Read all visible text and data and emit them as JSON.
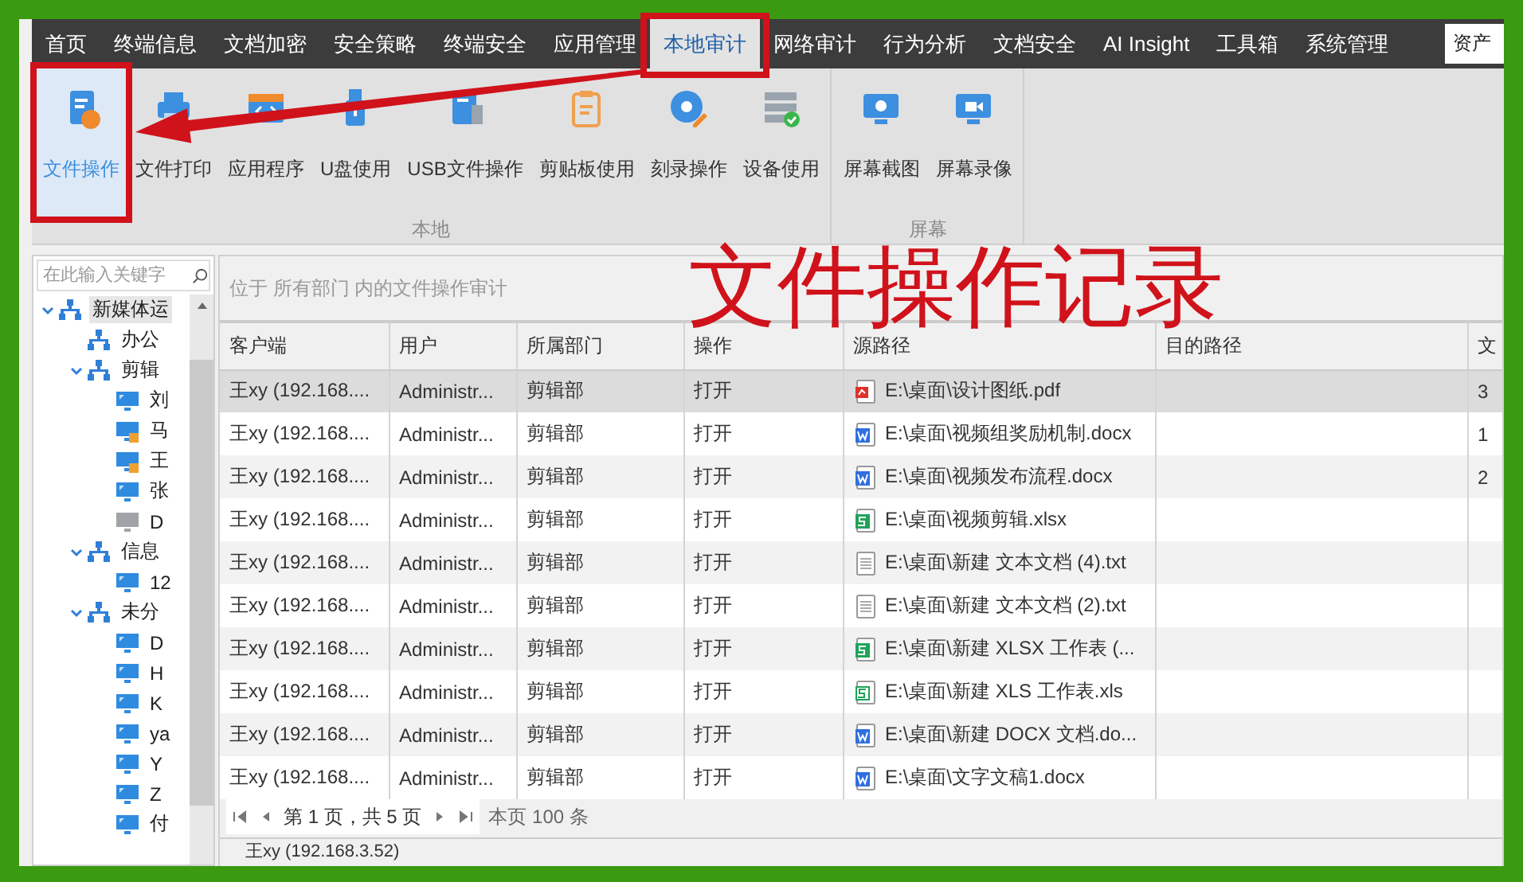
{
  "nav": {
    "items": [
      {
        "label": "首页",
        "selected": false
      },
      {
        "label": "终端信息",
        "selected": false
      },
      {
        "label": "文档加密",
        "selected": false
      },
      {
        "label": "安全策略",
        "selected": false
      },
      {
        "label": "终端安全",
        "selected": false
      },
      {
        "label": "应用管理",
        "selected": false
      },
      {
        "label": "本地审计",
        "selected": true
      },
      {
        "label": "网络审计",
        "selected": false
      },
      {
        "label": "行为分析",
        "selected": false
      },
      {
        "label": "文档安全",
        "selected": false
      },
      {
        "label": "AI Insight",
        "selected": false
      },
      {
        "label": "工具箱",
        "selected": false
      },
      {
        "label": "系统管理",
        "selected": false
      }
    ],
    "search": {
      "value": "资产"
    }
  },
  "ribbon": {
    "groups": [
      {
        "label": "本地",
        "items": [
          {
            "label": "文件操作",
            "selected": true
          },
          {
            "label": "文件打印",
            "selected": false
          },
          {
            "label": "应用程序",
            "selected": false
          },
          {
            "label": "U盘使用",
            "selected": false
          },
          {
            "label": "USB文件操作",
            "selected": false
          },
          {
            "label": "剪贴板使用",
            "selected": false
          },
          {
            "label": "刻录操作",
            "selected": false
          },
          {
            "label": "设备使用",
            "selected": false
          }
        ]
      },
      {
        "label": "屏幕",
        "items": [
          {
            "label": "屏幕截图",
            "selected": false
          },
          {
            "label": "屏幕录像",
            "selected": false
          }
        ]
      }
    ]
  },
  "sidebar": {
    "search": {
      "placeholder": "在此输入关键字"
    },
    "tree": [
      {
        "label": "新媒体运",
        "kind": "org",
        "selected": true,
        "expanded": true,
        "children": [
          {
            "label": "办公",
            "kind": "org",
            "selected": false
          },
          {
            "label": "剪辑",
            "kind": "org",
            "selected": false,
            "expanded": true,
            "children": [
              {
                "label": "刘",
                "kind": "computer",
                "selected": false
              },
              {
                "label": "马",
                "kind": "computer_locked",
                "selected": false
              },
              {
                "label": "王",
                "kind": "computer_locked",
                "selected": false
              },
              {
                "label": "张",
                "kind": "computer",
                "selected": false
              },
              {
                "label": "D",
                "kind": "computer_offline",
                "selected": false
              }
            ]
          },
          {
            "label": "信息",
            "kind": "org",
            "selected": false,
            "expanded": true,
            "children": [
              {
                "label": "12",
                "kind": "computer",
                "selected": false
              }
            ]
          },
          {
            "label": "未分",
            "kind": "org",
            "selected": false,
            "expanded": true,
            "children": [
              {
                "label": "D",
                "kind": "computer",
                "selected": false
              },
              {
                "label": "H",
                "kind": "computer",
                "selected": false
              },
              {
                "label": "K",
                "kind": "computer",
                "selected": false
              },
              {
                "label": "ya",
                "kind": "computer",
                "selected": false
              },
              {
                "label": "Y",
                "kind": "computer",
                "selected": false
              },
              {
                "label": "Z",
                "kind": "computer",
                "selected": false
              },
              {
                "label": "付",
                "kind": "computer",
                "selected": false
              }
            ]
          }
        ]
      }
    ]
  },
  "breadcrumb": "位于 所有部门 内的文件操作审计",
  "table": {
    "columns": [
      "客户端",
      "用户",
      "所属部门",
      "操作",
      "源路径",
      "目的路径",
      "文"
    ],
    "rows": [
      {
        "client": "王xy (192.168....",
        "user": "Administr...",
        "department": "剪辑部",
        "action": "打开",
        "source": {
          "kind": "pdf",
          "text": "E:\\桌面\\设计图纸.pdf"
        },
        "column_7": "3",
        "selected": true
      },
      {
        "client": "王xy (192.168....",
        "user": "Administr...",
        "department": "剪辑部",
        "action": "打开",
        "source": {
          "kind": "word",
          "text": "E:\\桌面\\视频组奖励机制.docx"
        },
        "column_7": "1",
        "selected": false
      },
      {
        "client": "王xy (192.168....",
        "user": "Administr...",
        "department": "剪辑部",
        "action": "打开",
        "source": {
          "kind": "word",
          "text": "E:\\桌面\\视频发布流程.docx"
        },
        "column_7": "2",
        "selected": false
      },
      {
        "client": "王xy (192.168....",
        "user": "Administr...",
        "department": "剪辑部",
        "action": "打开",
        "source": {
          "kind": "excel",
          "text": "E:\\桌面\\视频剪辑.xlsx"
        },
        "selected": false
      },
      {
        "client": "王xy (192.168....",
        "user": "Administr...",
        "department": "剪辑部",
        "action": "打开",
        "source": {
          "kind": "text",
          "text": "E:\\桌面\\新建 文本文档 (4).txt"
        },
        "selected": false
      },
      {
        "client": "王xy (192.168....",
        "user": "Administr...",
        "department": "剪辑部",
        "action": "打开",
        "source": {
          "kind": "text",
          "text": "E:\\桌面\\新建 文本文档 (2).txt"
        },
        "selected": false
      },
      {
        "client": "王xy (192.168....",
        "user": "Administr...",
        "department": "剪辑部",
        "action": "打开",
        "source": {
          "kind": "excel",
          "text": "E:\\桌面\\新建 XLSX 工作表 (..."
        },
        "selected": false
      },
      {
        "client": "王xy (192.168....",
        "user": "Administr...",
        "department": "剪辑部",
        "action": "打开",
        "source": {
          "kind": "excel_old",
          "text": "E:\\桌面\\新建 XLS 工作表.xls"
        },
        "selected": false
      },
      {
        "client": "王xy (192.168....",
        "user": "Administr...",
        "department": "剪辑部",
        "action": "打开",
        "source": {
          "kind": "word",
          "text": "E:\\桌面\\新建 DOCX 文档.do..."
        },
        "selected": false
      },
      {
        "client": "王xy (192.168....",
        "user": "Administr...",
        "department": "剪辑部",
        "action": "打开",
        "source": {
          "kind": "word",
          "text": "E:\\桌面\\文字文稿1.docx"
        },
        "selected": false
      }
    ]
  },
  "pagination": {
    "page_text": "第 1 页，共 5 页",
    "count_text": "本页 100 条"
  },
  "details": {
    "text": "王xy (192.168.3.52)"
  },
  "annotation": {
    "caption": "文件操作记录"
  }
}
